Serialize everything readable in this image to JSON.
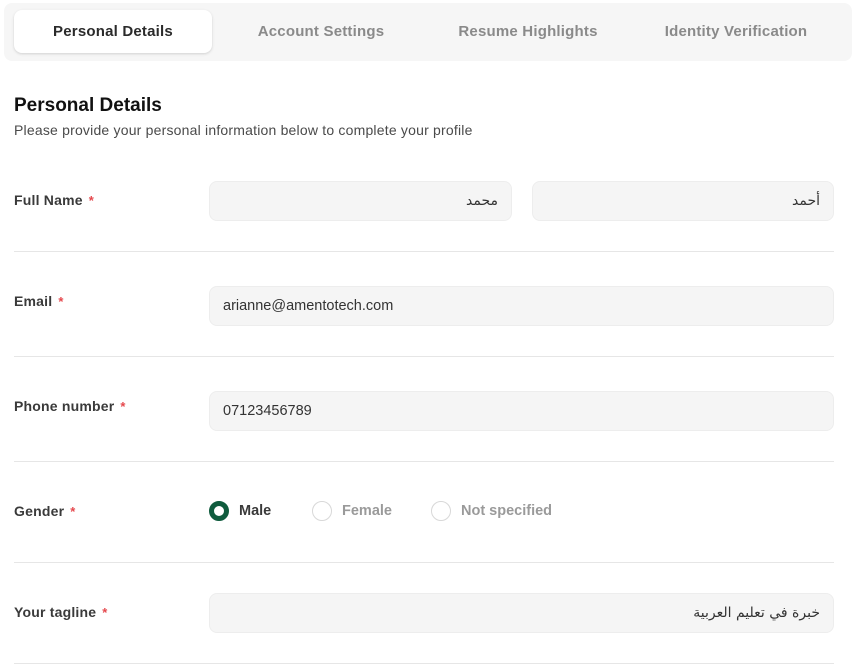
{
  "tabs": [
    {
      "label": "Personal Details",
      "active": true
    },
    {
      "label": "Account Settings",
      "active": false
    },
    {
      "label": "Resume Highlights",
      "active": false
    },
    {
      "label": "Identity Verification",
      "active": false
    }
  ],
  "section": {
    "title": "Personal Details",
    "subtitle": "Please provide your personal information below to complete your profile"
  },
  "form": {
    "required_marker": "*",
    "full_name": {
      "label": "Full Name",
      "first_value": "محمد",
      "last_value": "أحمد"
    },
    "email": {
      "label": "Email",
      "value": "arianne@amentotech.com"
    },
    "phone": {
      "label": "Phone number",
      "value": "07123456789"
    },
    "gender": {
      "label": "Gender",
      "options": [
        "Male",
        "Female",
        "Not specified"
      ],
      "selected": "Male"
    },
    "tagline": {
      "label": "Your tagline",
      "value": "خبرة في تعليم العربية"
    }
  },
  "colors": {
    "accent": "#0f5b3d",
    "required": "#e5484d",
    "field_bg": "#f5f5f5",
    "tabbar_bg": "#f6f6f6"
  }
}
